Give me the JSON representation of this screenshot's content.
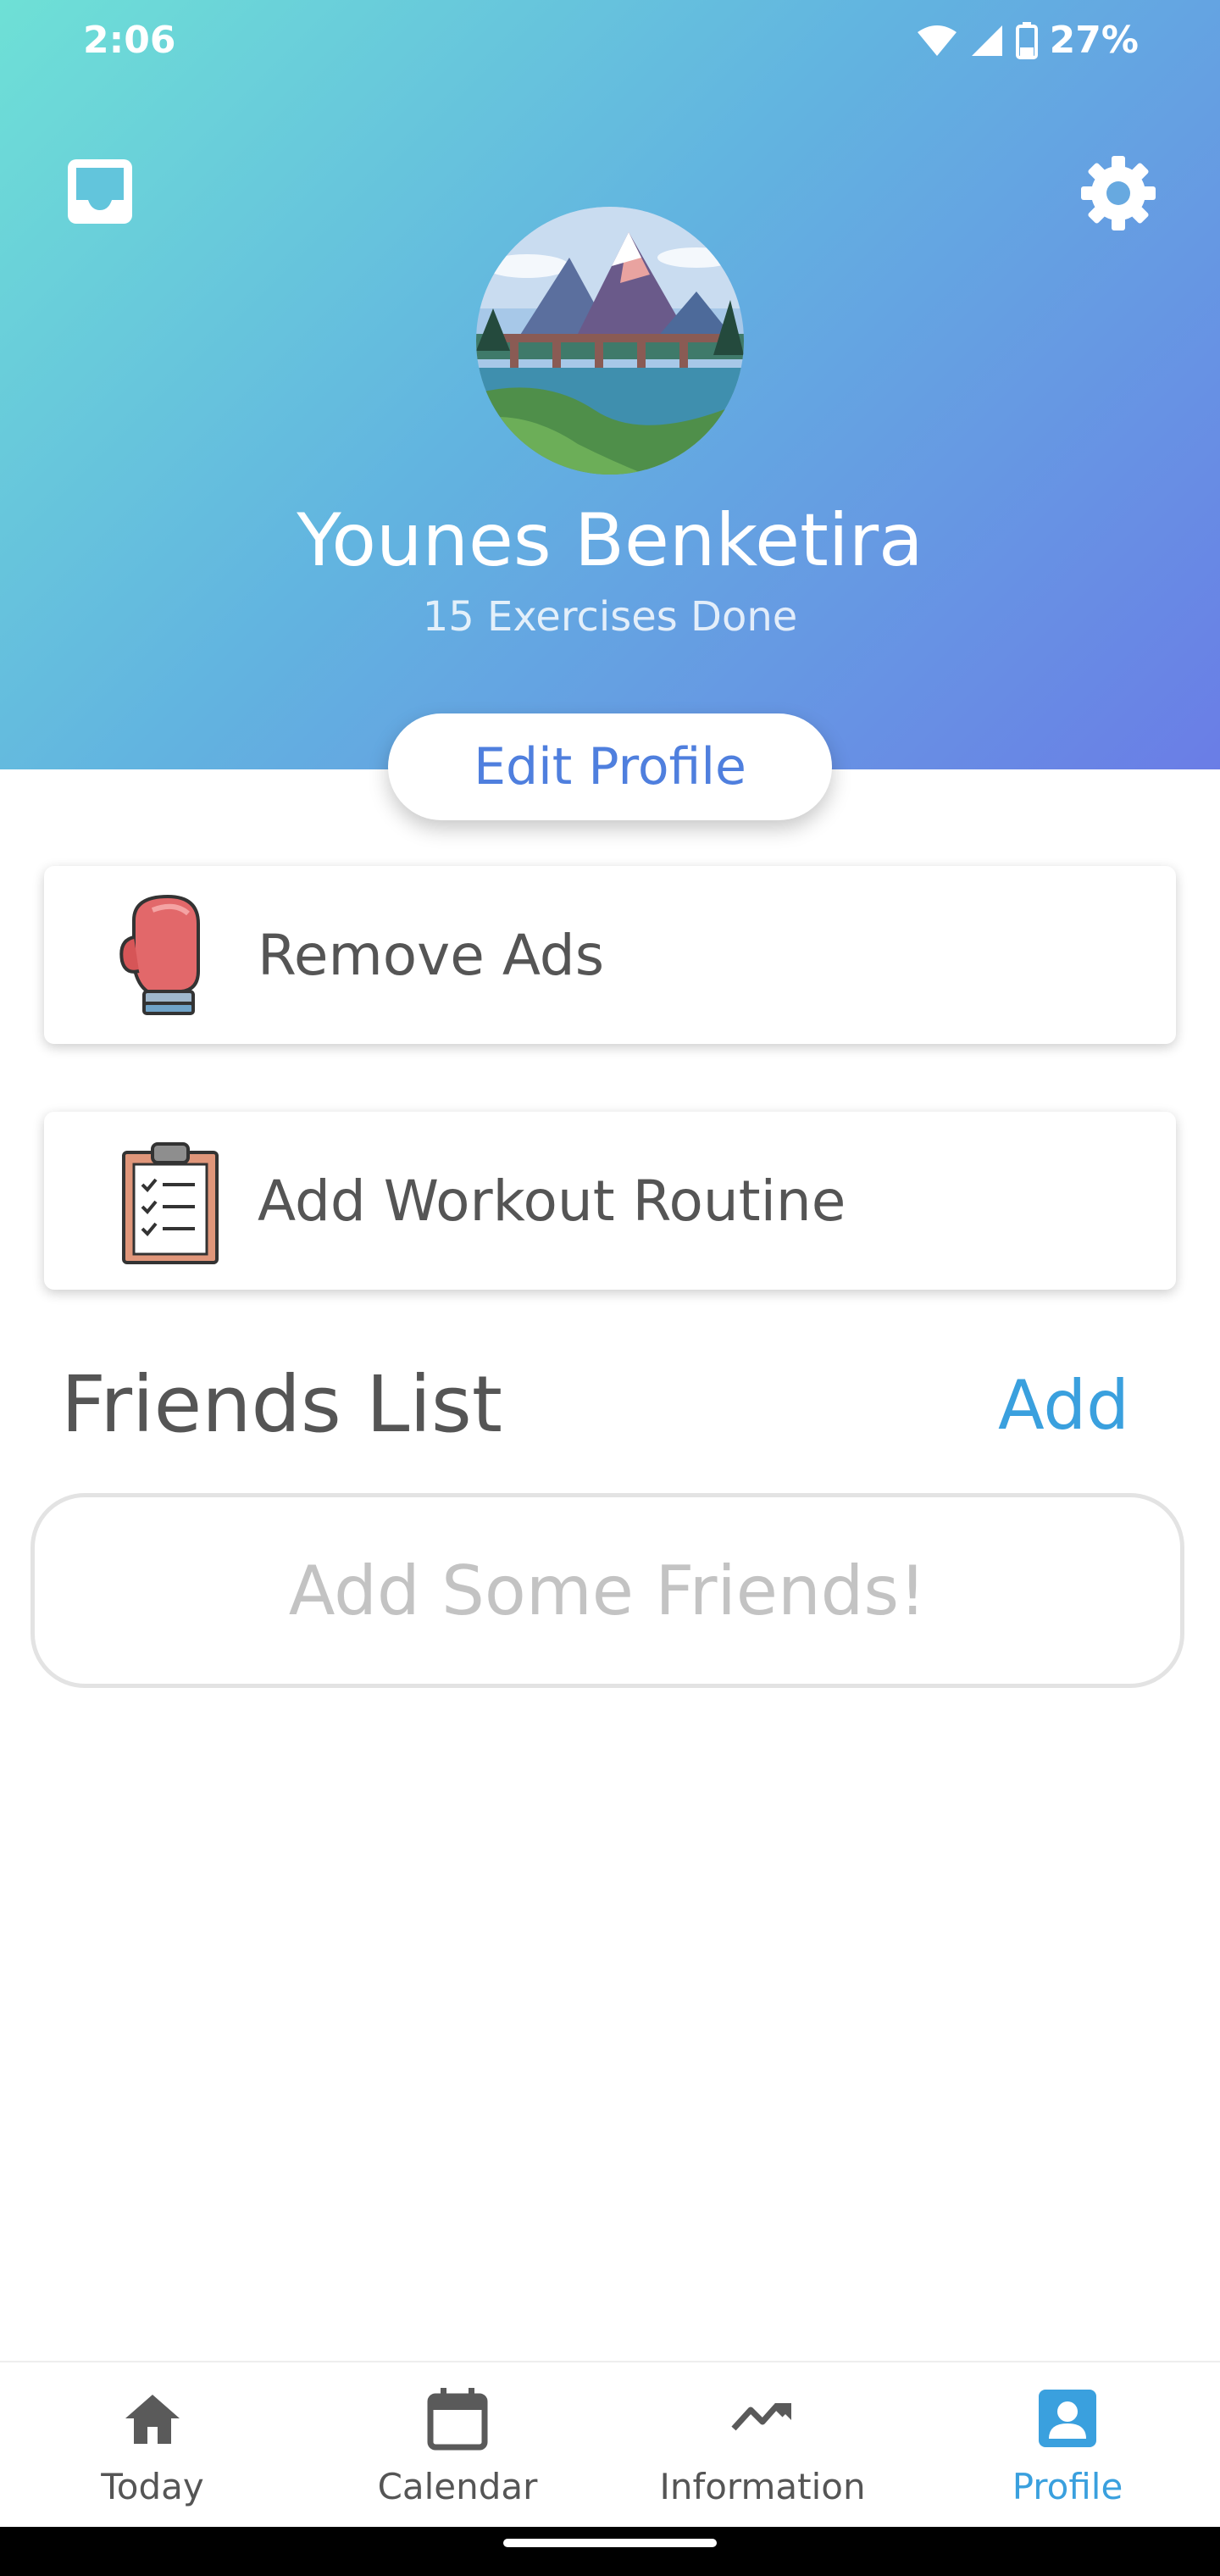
{
  "status": {
    "time": "2:06",
    "battery": "27%"
  },
  "profile": {
    "name": "Younes Benketira",
    "exercises": "15 Exercises Done",
    "edit_label": "Edit Profile"
  },
  "cards": [
    {
      "label": "Remove Ads",
      "icon": "boxing-glove-icon"
    },
    {
      "label": "Add Workout Routine",
      "icon": "clipboard-icon"
    }
  ],
  "friends": {
    "title": "Friends List",
    "add_label": "Add",
    "empty_text": "Add Some Friends!"
  },
  "nav": [
    {
      "label": "Today",
      "icon": "home-icon",
      "active": false
    },
    {
      "label": "Calendar",
      "icon": "calendar-icon",
      "active": false
    },
    {
      "label": "Information",
      "icon": "trend-icon",
      "active": false
    },
    {
      "label": "Profile",
      "icon": "profile-icon",
      "active": true
    }
  ],
  "colors": {
    "accent": "#3aa0de",
    "edit_text": "#4f7fde",
    "gradient_start": "#6ee0d6",
    "gradient_end": "#6a7de6"
  }
}
